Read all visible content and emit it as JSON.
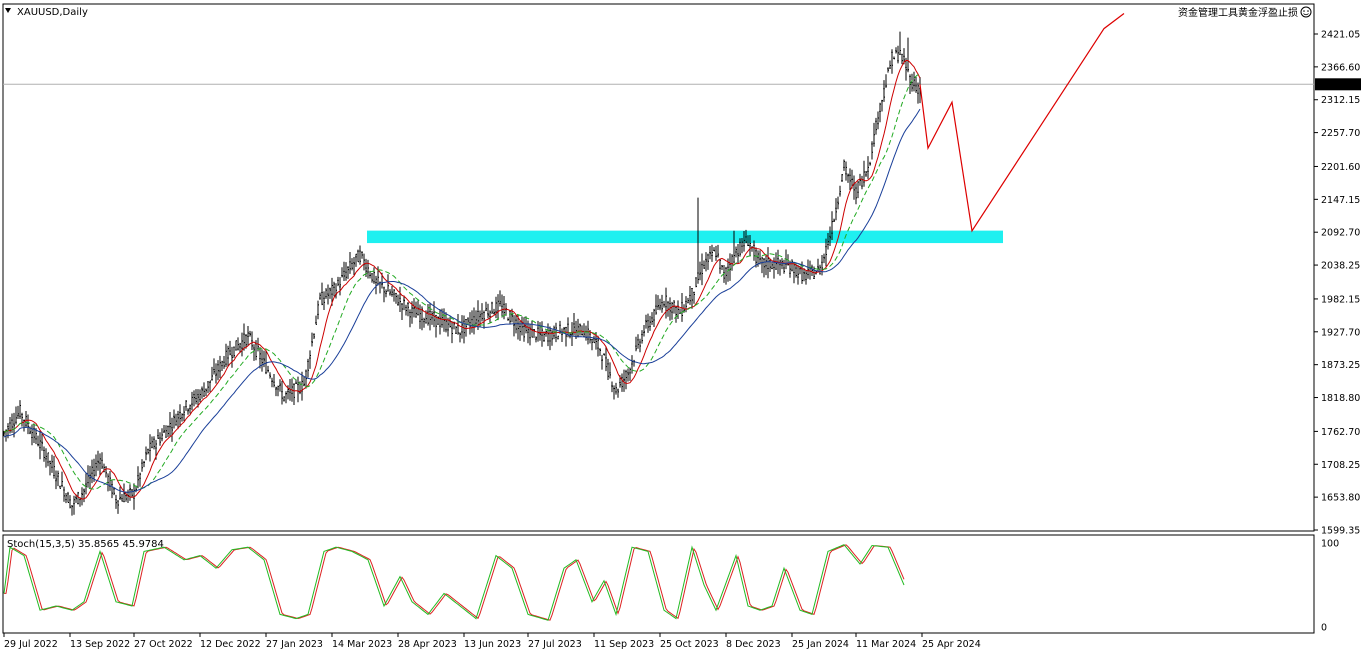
{
  "chart_data": {
    "type": "candlestick",
    "symbol_timeframe": "XAUUSD,Daily",
    "watermark": "资金管理工具黄金浮盈止损",
    "y_ticks": [
      "2421.05",
      "2366.60",
      "2312.15",
      "2257.70",
      "2201.60",
      "2147.15",
      "2092.70",
      "2038.25",
      "1982.15",
      "1927.70",
      "1873.25",
      "1818.80",
      "1762.70",
      "1708.25",
      "1653.80",
      "1599.35"
    ],
    "ylim": [
      1599.35,
      2421.05
    ],
    "current_price": "2337.72",
    "resistance_zone": [
      2078,
      2092
    ],
    "x_ticks": [
      "29 Jul 2022",
      "13 Sep 2022",
      "27 Oct 2022",
      "12 Dec 2022",
      "27 Jan 2023",
      "14 Mar 2023",
      "28 Apr 2023",
      "13 Jun 2023",
      "27 Jul 2023",
      "11 Sep 2023",
      "25 Oct 2023",
      "8 Dec 2023",
      "25 Jan 2024",
      "11 Mar 2024",
      "25 Apr 2024"
    ],
    "x_tick_positions": [
      0,
      33,
      65,
      98,
      131,
      164,
      197,
      230,
      262,
      295,
      328,
      361,
      394,
      426,
      459
    ],
    "price_path": [
      [
        0,
        1760
      ],
      [
        8,
        1795
      ],
      [
        20,
        1730
      ],
      [
        34,
        1640
      ],
      [
        40,
        1665
      ],
      [
        48,
        1720
      ],
      [
        56,
        1650
      ],
      [
        65,
        1660
      ],
      [
        72,
        1730
      ],
      [
        80,
        1760
      ],
      [
        90,
        1800
      ],
      [
        100,
        1830
      ],
      [
        112,
        1890
      ],
      [
        122,
        1920
      ],
      [
        131,
        1870
      ],
      [
        140,
        1820
      ],
      [
        150,
        1840
      ],
      [
        158,
        1980
      ],
      [
        166,
        2000
      ],
      [
        172,
        2030
      ],
      [
        178,
        2055
      ],
      [
        186,
        2010
      ],
      [
        194,
        1990
      ],
      [
        204,
        1960
      ],
      [
        214,
        1950
      ],
      [
        228,
        1930
      ],
      [
        240,
        1960
      ],
      [
        248,
        1970
      ],
      [
        260,
        1930
      ],
      [
        270,
        1920
      ],
      [
        280,
        1930
      ],
      [
        290,
        1930
      ],
      [
        298,
        1900
      ],
      [
        306,
        1830
      ],
      [
        312,
        1860
      ],
      [
        320,
        1930
      ],
      [
        330,
        1980
      ],
      [
        338,
        1960
      ],
      [
        344,
        1990
      ],
      [
        350,
        2040
      ],
      [
        356,
        2060
      ],
      [
        360,
        2020
      ],
      [
        366,
        2060
      ],
      [
        372,
        2080
      ],
      [
        378,
        2040
      ],
      [
        386,
        2040
      ],
      [
        394,
        2035
      ],
      [
        400,
        2020
      ],
      [
        408,
        2030
      ],
      [
        414,
        2100
      ],
      [
        420,
        2200
      ],
      [
        426,
        2160
      ],
      [
        432,
        2200
      ],
      [
        438,
        2300
      ],
      [
        444,
        2380
      ],
      [
        448,
        2390
      ],
      [
        454,
        2340
      ],
      [
        458,
        2330
      ]
    ],
    "candle_noise": 22,
    "spikes": [
      [
        347,
        2150
      ],
      [
        365,
        2095
      ],
      [
        448,
        2425
      ],
      [
        452,
        2415
      ]
    ],
    "projection": [
      [
        458,
        2337.72
      ],
      [
        462,
        2232
      ],
      [
        474,
        2308
      ],
      [
        484,
        2095
      ],
      [
        550,
        2430
      ],
      [
        560,
        2455
      ]
    ],
    "ma_fast_color": "#cc0000",
    "ma_mid_color": "#22aa22",
    "ma_slow_color": "#1a3f99",
    "zone_color": "#1ff0f0",
    "projection_color": "#dd0000",
    "stochastic": {
      "label": "Stoch(15,3,5) 35.8565 45.9784",
      "levels": [
        "100",
        "0"
      ],
      "ylim": [
        0,
        100
      ],
      "main_color": "#22bb22",
      "signal_color": "#dd2222",
      "path": [
        [
          0,
          40
        ],
        [
          3,
          95
        ],
        [
          10,
          85
        ],
        [
          18,
          20
        ],
        [
          26,
          25
        ],
        [
          34,
          20
        ],
        [
          40,
          30
        ],
        [
          48,
          90
        ],
        [
          56,
          30
        ],
        [
          64,
          25
        ],
        [
          70,
          90
        ],
        [
          80,
          95
        ],
        [
          90,
          80
        ],
        [
          98,
          85
        ],
        [
          106,
          70
        ],
        [
          114,
          92
        ],
        [
          122,
          95
        ],
        [
          130,
          80
        ],
        [
          138,
          15
        ],
        [
          146,
          10
        ],
        [
          152,
          15
        ],
        [
          160,
          90
        ],
        [
          166,
          95
        ],
        [
          174,
          90
        ],
        [
          182,
          80
        ],
        [
          190,
          25
        ],
        [
          198,
          60
        ],
        [
          204,
          30
        ],
        [
          212,
          15
        ],
        [
          220,
          40
        ],
        [
          228,
          25
        ],
        [
          236,
          10
        ],
        [
          246,
          85
        ],
        [
          254,
          70
        ],
        [
          262,
          15
        ],
        [
          272,
          8
        ],
        [
          280,
          70
        ],
        [
          286,
          80
        ],
        [
          294,
          30
        ],
        [
          300,
          55
        ],
        [
          306,
          15
        ],
        [
          314,
          95
        ],
        [
          322,
          90
        ],
        [
          330,
          20
        ],
        [
          336,
          10
        ],
        [
          344,
          95
        ],
        [
          350,
          50
        ],
        [
          356,
          20
        ],
        [
          366,
          85
        ],
        [
          372,
          25
        ],
        [
          378,
          20
        ],
        [
          384,
          25
        ],
        [
          390,
          70
        ],
        [
          398,
          20
        ],
        [
          404,
          15
        ],
        [
          412,
          90
        ],
        [
          420,
          98
        ],
        [
          428,
          75
        ],
        [
          434,
          97
        ],
        [
          442,
          95
        ],
        [
          450,
          50
        ]
      ]
    }
  }
}
